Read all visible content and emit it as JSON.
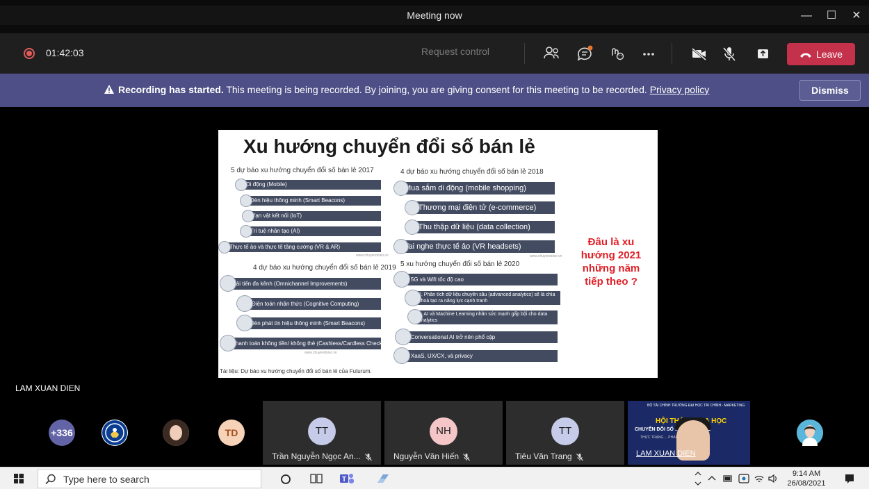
{
  "window": {
    "title": "Meeting now",
    "controls": {
      "minimize": "—",
      "maximize": "☐",
      "close": "✕"
    }
  },
  "toolbar": {
    "timer": "01:42:03",
    "request_control": "Request control",
    "leave_label": "Leave",
    "icons": [
      "people-icon",
      "chat-icon",
      "reactions-icon",
      "more-icon",
      "camera-off-icon",
      "mic-off-icon",
      "share-icon"
    ],
    "leave_color": "#c4314b"
  },
  "banner": {
    "bold": "Recording has started.",
    "text": " This meeting is being recorded. By joining, you are giving consent for this meeting to be recorded. ",
    "link": "Privacy policy",
    "dismiss": "Dismiss",
    "color": "#4d4f86"
  },
  "slide": {
    "title": "Xu hướng chuyển đổi số bán lẻ",
    "sec2017": {
      "title": "5 dự báo xu hướng chuyển đổi số bán lẻ 2017",
      "items": [
        "Di động (Mobile)",
        "Đèn hiệu thông minh (Smart Beacons)",
        "Vạn vật kết nối (IoT)",
        "Trí tuệ nhân tạo (AI)",
        "Thực tế ảo và thực tế tăng cường (VR & AR)"
      ],
      "source": "www.chuyendoiso.vn"
    },
    "sec2018": {
      "title": "4 dự báo xu hướng chuyển đổi số bán lẻ 2018",
      "items": [
        "Mua sắm di động (mobile shopping)",
        "Thương mại điện tử (e-commerce)",
        "Thu thập dữ liệu (data collection)",
        "Tai nghe thực tế ảo (VR headsets)"
      ],
      "source": "www.chuyendoiso.vn"
    },
    "sec2019": {
      "title": "4 dự báo xu hướng chuyển đổi số bán lẻ 2019",
      "items": [
        "Cải tiến đa kênh (Omnichannel Improvements)",
        "Điện toán nhận thức (Cognitive Computing)",
        "Đèn phát tín hiệu thông minh (Smart Beacons)",
        "Thanh toán không tiền/ không thẻ (Cashless/Cardless Checkouts)"
      ],
      "source": "www.chuyendoiso.vn"
    },
    "sec2020": {
      "title": "5 xu hướng chuyển đổi số bán lẻ 2020",
      "items": [
        "1. 5G và Wifi tốc độ cao",
        "2. Phân tích dữ liệu chuyên sâu (advanced analytics) sẽ là chìa khoá tạo ra năng lực cạnh tranh",
        "3. AI và Machine Learning nhân sức mạnh gấp bội cho data analytics",
        "4. Conversational AI trở nên phổ cập",
        "5. XaaS, UX/CX, và privacy"
      ]
    },
    "question": "Đâu là xu hướng 2021 những năm tiếp theo ?",
    "citation": "Tài liệu: Dự báo xu hướng chuyển đổi số bán lẻ của Futurum."
  },
  "presenter": {
    "name": "LAM XUAN DIEN"
  },
  "participants": {
    "overflow": "+336",
    "avatar_td": "TD",
    "tiles": [
      {
        "initials": "TT",
        "name": "Trần Nguyễn Ngọc An...",
        "color": "#c5cbe8"
      },
      {
        "initials": "NH",
        "name": "Nguyễn Văn Hiến",
        "color": "#f4c6c8"
      },
      {
        "initials": "TT",
        "name": "Tiêu Văn Trang",
        "color": "#c5cbe8"
      }
    ],
    "video": {
      "header": "BỘ TÀI CHÍNH TRƯỜNG ĐẠI HỌC TÀI CHÍNH - MARKETING",
      "headline": "HỘI THẢO ... ỌA HỌC",
      "line2": "CHUYỂN ĐỔI SỐ ... VỰC BÁN LẺ",
      "line3": "THỰC TRẠNG ... PHÁP",
      "name": "LAM XUAN DIEN"
    }
  },
  "taskbar": {
    "search_placeholder": "Type here to search",
    "time": "9:14 AM",
    "date": "26/08/2021"
  }
}
